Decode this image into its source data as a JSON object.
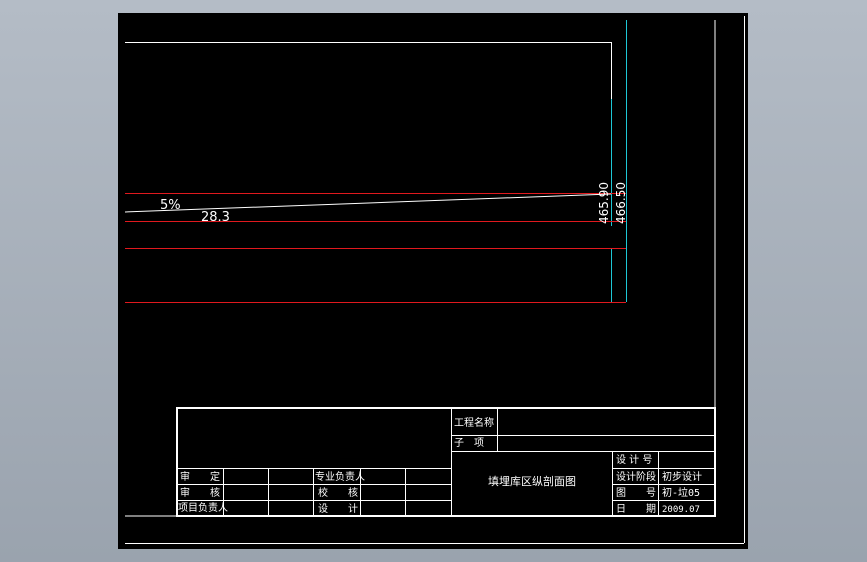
{
  "colors": {
    "background": "#000000",
    "outline": "#ffffff",
    "section_line": "#e0191e",
    "elevation_line": "#1ec8d6"
  },
  "drawing": {
    "slope_label": "5%",
    "length_label": "28.3",
    "elevation_left": "465.90",
    "elevation_right": "466.50"
  },
  "title_block": {
    "project_name_label": "工程名称",
    "sub_item_label": "子　项",
    "drawing_title": "填埋库区纵剖面图",
    "approve_label": "审　　定",
    "review_label": "审　　核",
    "project_lead_label": "项目负责人",
    "discipline_lead_label": "专业负责人",
    "check_label": "校　　核",
    "designer_label": "设　　计",
    "design_no_label": "设 计 号",
    "design_stage_label": "设计阶段",
    "design_stage_value": "初步设计",
    "drawing_no_label": "图　　号",
    "drawing_no_value": "初-垃05",
    "date_label": "日　　期",
    "date_value": "2009.07"
  }
}
